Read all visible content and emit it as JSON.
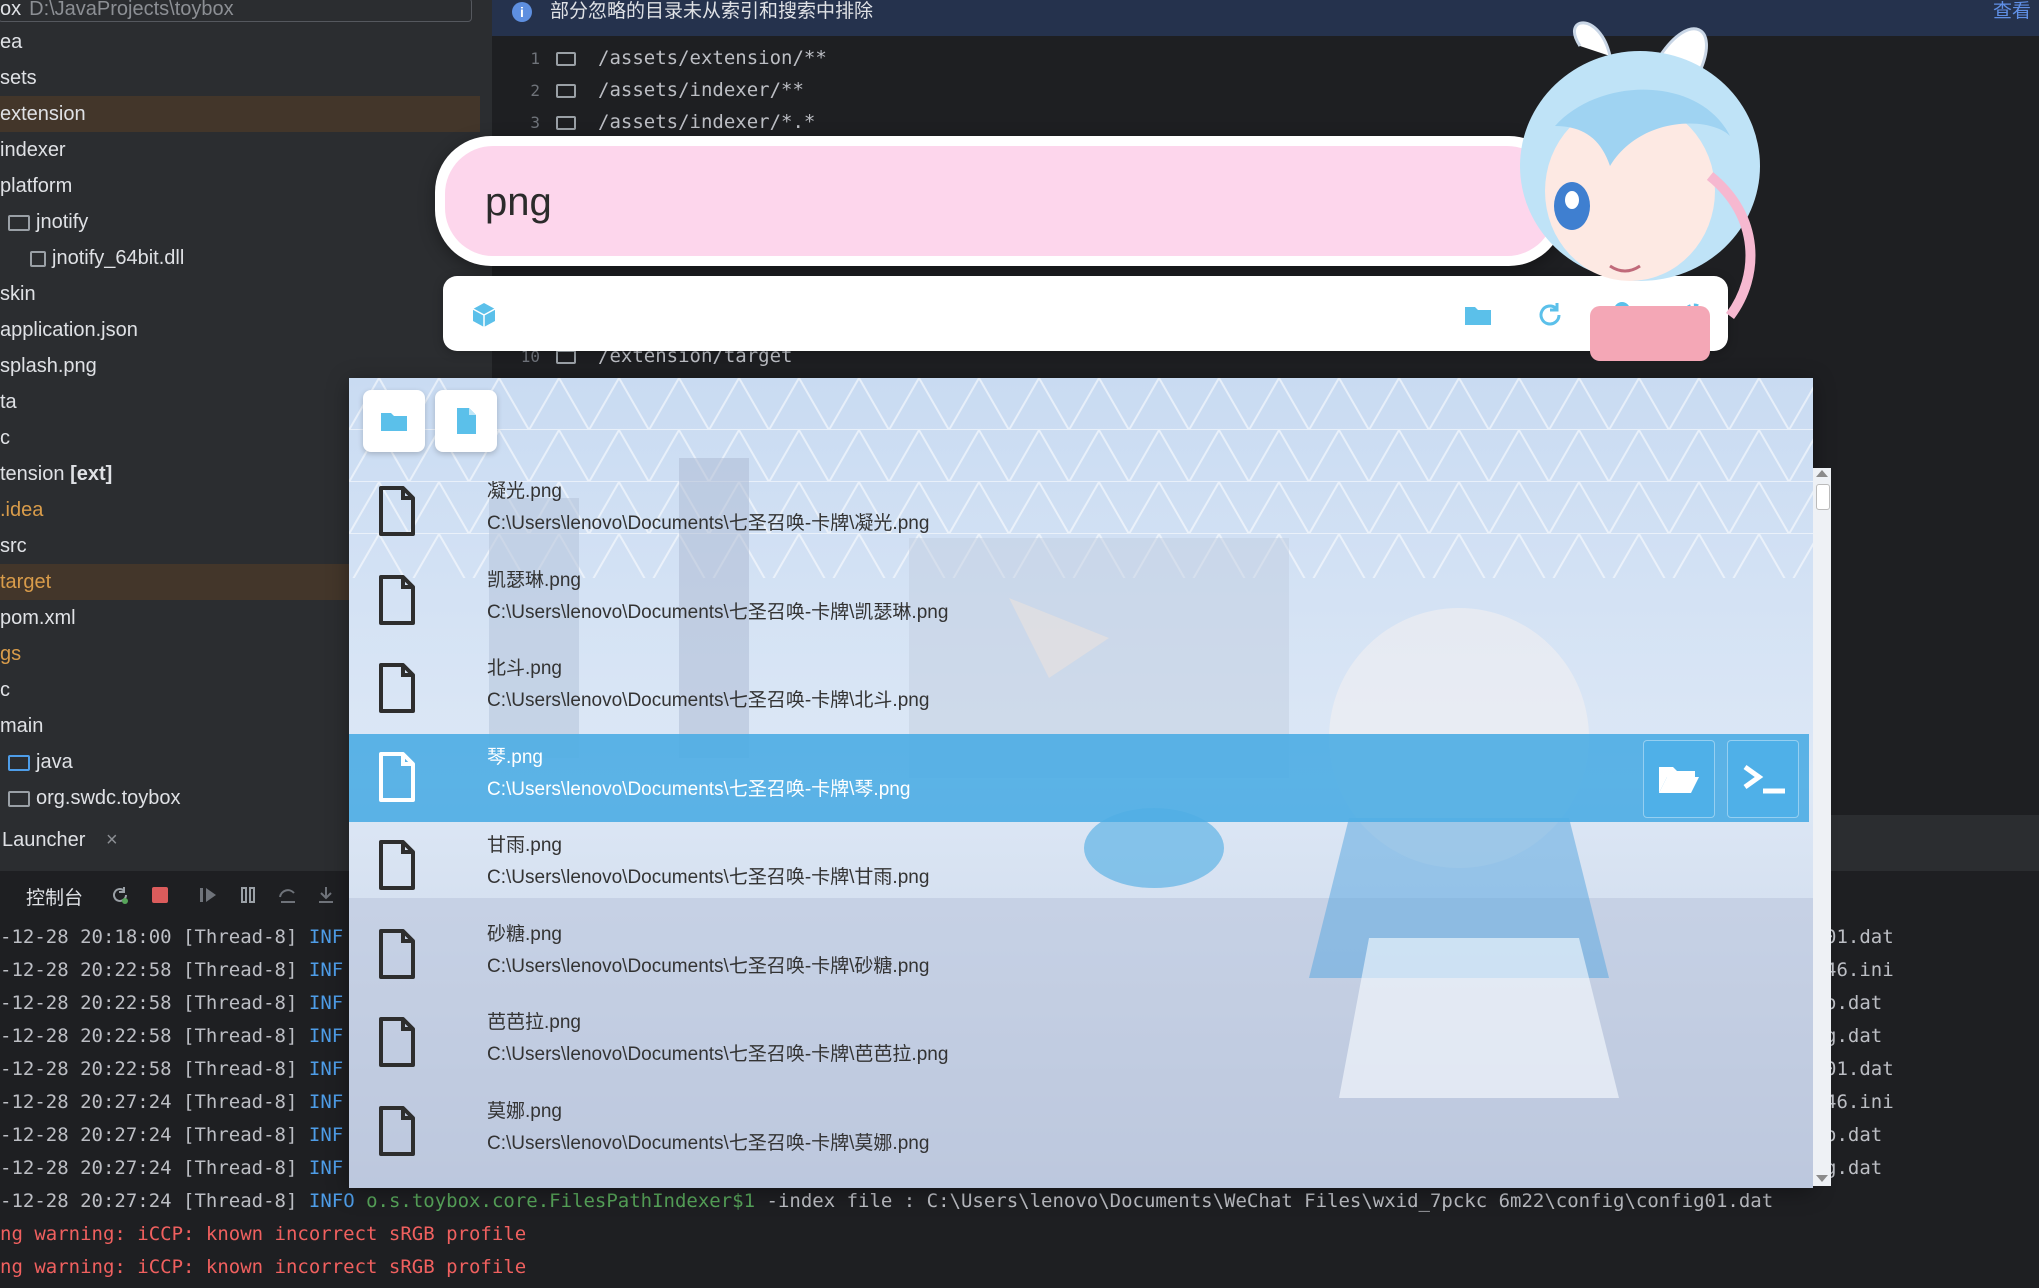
{
  "ide": {
    "project": {
      "root_name": "ox",
      "root_path": "D:\\JavaProjects\\toybox",
      "items": [
        {
          "label": "ea",
          "style": "normal",
          "selected": false
        },
        {
          "label": "sets",
          "style": "normal",
          "selected": false
        },
        {
          "label": "extension",
          "style": "normal",
          "selected": true
        },
        {
          "label": "indexer",
          "style": "normal",
          "selected": false
        },
        {
          "label": "platform",
          "style": "normal",
          "selected": false
        },
        {
          "label": "jnotify",
          "style": "normal",
          "selected": false
        },
        {
          "label": "jnotify_64bit.dll",
          "style": "normal",
          "selected": false
        },
        {
          "label": "skin",
          "style": "normal",
          "selected": false
        },
        {
          "label": "application.json",
          "style": "normal",
          "selected": false
        },
        {
          "label": "splash.png",
          "style": "normal",
          "selected": false
        },
        {
          "label": "ta",
          "style": "normal",
          "selected": false
        },
        {
          "label": "c",
          "style": "normal",
          "selected": false
        },
        {
          "label": "tension [ext]",
          "style": "bold",
          "selected": false
        },
        {
          "label": ".idea",
          "style": "orange",
          "selected": false
        },
        {
          "label": "src",
          "style": "normal",
          "selected": false
        },
        {
          "label": "target",
          "style": "orange",
          "selected": true
        },
        {
          "label": "pom.xml",
          "style": "normal",
          "selected": false
        },
        {
          "label": "gs",
          "style": "orange",
          "selected": false
        },
        {
          "label": "c",
          "style": "normal",
          "selected": false
        },
        {
          "label": "main",
          "style": "normal",
          "selected": false
        },
        {
          "label": "java",
          "style": "normal",
          "selected": false
        },
        {
          "label": "org.swdc.toybox",
          "style": "normal",
          "selected": false
        }
      ]
    },
    "editor": {
      "banner_message": "部分忽略的目录未从索引和搜索中排除",
      "banner_link": "查看",
      "lines": [
        {
          "num": "1",
          "code": "/assets/extension/**"
        },
        {
          "num": "2",
          "code": "/assets/indexer/**"
        },
        {
          "num": "3",
          "code": "/assets/indexer/*.*"
        },
        {
          "num": "10",
          "code": "/extension/target"
        }
      ]
    },
    "run": {
      "tab_label": "Launcher",
      "tab_close": "×",
      "console_label": "控制台",
      "log_lines": [
        {
          "ts": "-12-28 20:18:00",
          "thread": "[Thread-8]",
          "lvl": "INF",
          "right": "01.dat"
        },
        {
          "ts": "-12-28 20:22:58",
          "thread": "[Thread-8]",
          "lvl": "INF",
          "right": "46.ini"
        },
        {
          "ts": "-12-28 20:22:58",
          "thread": "[Thread-8]",
          "lvl": "INF",
          "right": "o.dat"
        },
        {
          "ts": "-12-28 20:22:58",
          "thread": "[Thread-8]",
          "lvl": "INF",
          "right": "g.dat"
        },
        {
          "ts": "-12-28 20:22:58",
          "thread": "[Thread-8]",
          "lvl": "INF",
          "right": "01.dat"
        },
        {
          "ts": "-12-28 20:27:24",
          "thread": "[Thread-8]",
          "lvl": "INF",
          "right": "46.ini"
        },
        {
          "ts": "-12-28 20:27:24",
          "thread": "[Thread-8]",
          "lvl": "INF",
          "right": "o.dat"
        },
        {
          "ts": "-12-28 20:27:24",
          "thread": "[Thread-8]",
          "lvl": "INF",
          "right": "g.dat"
        }
      ],
      "full_line": {
        "ts": "-12-28 20:27:24",
        "thread": "[Thread-8]",
        "lvl": "INFO",
        "cls": "o.s.toybox.core.FilesPathIndexer$1",
        "msg": "-index file : C:\\Users\\lenovo\\Documents\\WeChat Files\\wxid_7pckc",
        "tail": "6m22\\config\\config01.dat"
      },
      "warnings": [
        "ng warning: iCCP: known incorrect sRGB profile",
        "ng warning: iCCP: known incorrect sRGB profile"
      ]
    }
  },
  "launcher": {
    "search_query": "png",
    "colors": {
      "search_bg": "#fdd6ec",
      "accent": "#4fb0e8",
      "selected_row": "#4faee4"
    },
    "plugin_icons": [
      "cube-icon",
      "folder-icon",
      "refresh-icon",
      "pin-icon",
      "gear-icon"
    ],
    "type_filters": [
      "folder-icon",
      "file-icon"
    ],
    "results": [
      {
        "name": "凝光.png",
        "path": "C:\\Users\\lenovo\\Documents\\七圣召唤-卡牌\\凝光.png",
        "selected": false
      },
      {
        "name": "凯瑟琳.png",
        "path": "C:\\Users\\lenovo\\Documents\\七圣召唤-卡牌\\凯瑟琳.png",
        "selected": false
      },
      {
        "name": "北斗.png",
        "path": "C:\\Users\\lenovo\\Documents\\七圣召唤-卡牌\\北斗.png",
        "selected": false
      },
      {
        "name": "琴.png",
        "path": "C:\\Users\\lenovo\\Documents\\七圣召唤-卡牌\\琴.png",
        "selected": true
      },
      {
        "name": "甘雨.png",
        "path": "C:\\Users\\lenovo\\Documents\\七圣召唤-卡牌\\甘雨.png",
        "selected": false
      },
      {
        "name": "砂糖.png",
        "path": "C:\\Users\\lenovo\\Documents\\七圣召唤-卡牌\\砂糖.png",
        "selected": false
      },
      {
        "name": "芭芭拉.png",
        "path": "C:\\Users\\lenovo\\Documents\\七圣召唤-卡牌\\芭芭拉.png",
        "selected": false
      },
      {
        "name": "莫娜.png",
        "path": "C:\\Users\\lenovo\\Documents\\七圣召唤-卡牌\\莫娜.png",
        "selected": false
      }
    ],
    "actions": [
      "open-folder-icon",
      "terminal-icon"
    ]
  }
}
